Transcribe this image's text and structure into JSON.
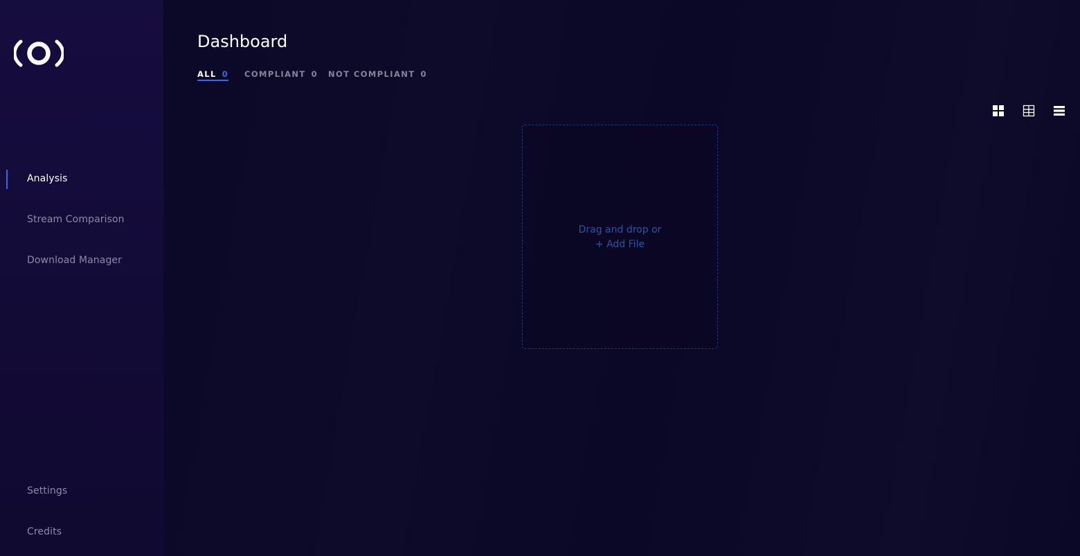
{
  "sidebar": {
    "logo_icon": "orbit-logo-icon",
    "nav_items": [
      {
        "label": "Analysis",
        "active": true
      },
      {
        "label": "Stream Comparison",
        "active": false
      },
      {
        "label": "Download Manager",
        "active": false
      }
    ],
    "bottom_items": [
      {
        "label": "Settings"
      },
      {
        "label": "Credits"
      }
    ]
  },
  "main": {
    "title": "Dashboard",
    "tabs": [
      {
        "label": "ALL",
        "count": "0",
        "active": true
      },
      {
        "label": "COMPLIANT",
        "count": "0",
        "active": false
      },
      {
        "label": "NOT COMPLIANT",
        "count": "0",
        "active": false
      }
    ],
    "view_toggles": [
      "grid-large-icon",
      "grid-small-icon",
      "list-icon"
    ],
    "dropzone": {
      "line1": "Drag and drop or",
      "line2": "+ Add File"
    }
  },
  "colors": {
    "background": "#0b0727",
    "sidebar": "#130b38",
    "accent": "#2d6cf0",
    "dropzone_text": "#2a54a8",
    "muted_text": "#8e8aa6"
  }
}
